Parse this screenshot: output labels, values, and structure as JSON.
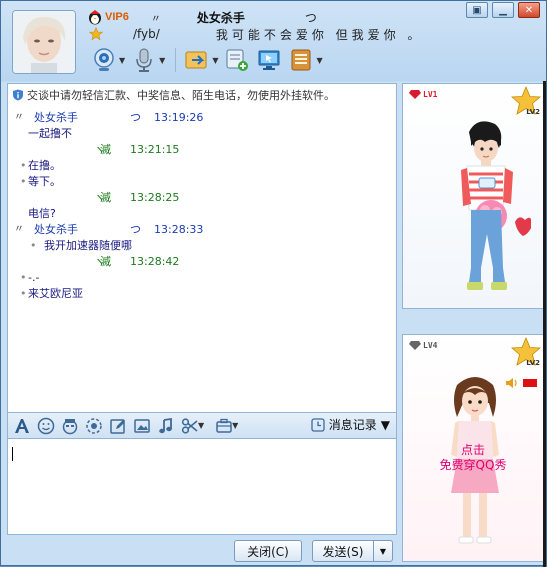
{
  "header": {
    "vip_label": "VIP6",
    "nick_pre": "〃",
    "nickname": "处女杀手",
    "nick_post": "つ",
    "sig_code": "/fyb/",
    "signature": "我可能不会爱你 但我爱你 。"
  },
  "icons": {
    "video": "webcam-icon",
    "voice": "microphone-icon",
    "transfer": "file-transfer-icon",
    "group": "create-discussion-icon",
    "remote": "remote-desktop-icon",
    "apps": "app-box-icon"
  },
  "chat": {
    "notice": "交谈中请勿轻信汇款、中奖信息、陌生电话，勿使用外挂软件。",
    "messages": [
      {
        "kind": "header",
        "side": "them",
        "mark": "〃",
        "who": "处女杀手",
        "who2": "つ",
        "time": "13:19:26"
      },
      {
        "kind": "text",
        "side": "them",
        "bullet": "",
        "text": "一起撸不"
      },
      {
        "kind": "header",
        "side": "me",
        "mark": "",
        "who2": "ヽ",
        "who": "滅",
        "time": "13:21:15"
      },
      {
        "kind": "text",
        "side": "me",
        "bullet": "•",
        "text": "在撸。"
      },
      {
        "kind": "text",
        "side": "me",
        "bullet": "•",
        "text": "等下。"
      },
      {
        "kind": "header",
        "side": "me",
        "mark": "",
        "who2": "ヽ",
        "who": "滅",
        "time": "13:28:25"
      },
      {
        "kind": "text",
        "side": "them",
        "bullet": "",
        "text": "电信?"
      },
      {
        "kind": "header",
        "side": "them",
        "mark": "〃",
        "who": "处女杀手",
        "who2": "つ",
        "time": "13:28:33"
      },
      {
        "kind": "text",
        "side": "them",
        "bullet": "•",
        "text": "我开加速器随便哪"
      },
      {
        "kind": "header",
        "side": "me",
        "mark": "",
        "who2": "ヽ",
        "who": "滅",
        "time": "13:28:42"
      },
      {
        "kind": "text",
        "side": "me",
        "bullet": "•",
        "text": "-.-"
      },
      {
        "kind": "text",
        "side": "me",
        "bullet": "•",
        "text": "来艾欧尼亚"
      }
    ]
  },
  "format_bar": {
    "history_label": "消息记录"
  },
  "buttons": {
    "close_label": "关闭(C)",
    "send_label": "发送(S)"
  },
  "show1": {
    "level": "LV1",
    "star_level": "LV2"
  },
  "show2": {
    "level": "LV4",
    "star_level": "LV2",
    "promo_line1": "点击",
    "promo_line2": "免费穿QQ秀"
  },
  "colors": {
    "accent_blue": "#1b3cb0",
    "self_green": "#1e7a1e",
    "vip_orange": "#e05a00",
    "promo_pink": "#e0006e"
  }
}
